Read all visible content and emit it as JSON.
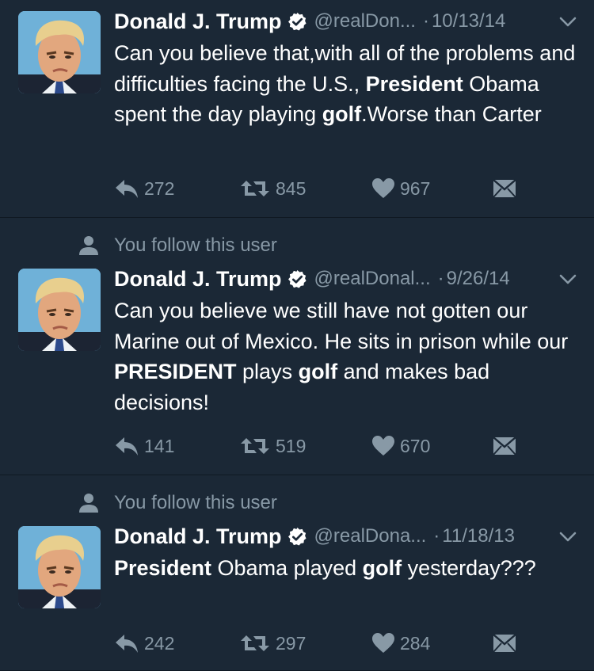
{
  "colors": {
    "background": "#1b2836",
    "muted": "#8899a6",
    "text": "#ffffff",
    "divider": "#0f1822"
  },
  "tweets": [
    {
      "name": "Donald J. Trump",
      "handle": "@realDon...",
      "dot": "·",
      "date": "10/13/14",
      "text_parts": [
        "Can you believe that,with all of the problems and difficulties facing the U.S., ",
        "President",
        " Obama spent the day playing ",
        "golf",
        ".Worse than Carter"
      ],
      "replies": "272",
      "retweets": "845",
      "likes": "967"
    },
    {
      "context": "You follow this user",
      "name": "Donald J. Trump",
      "handle": "@realDonal...",
      "dot": "·",
      "date": "9/26/14",
      "text_parts": [
        "Can you believe we still have not gotten our Marine out of Mexico. He sits in prison while our ",
        "PRESIDENT",
        " plays ",
        "golf",
        " and makes bad decisions!"
      ],
      "replies": "141",
      "retweets": "519",
      "likes": "670"
    },
    {
      "context": "You follow this user",
      "name": "Donald J. Trump",
      "handle": "@realDona...",
      "dot": "·",
      "date": "11/18/13",
      "text_parts": [
        "",
        "President",
        " Obama played ",
        "golf",
        " yesterday???"
      ],
      "replies": "242",
      "retweets": "297",
      "likes": "284"
    }
  ],
  "icons": [
    "person-icon",
    "verified-badge-icon",
    "chevron-down-icon",
    "reply-icon",
    "retweet-icon",
    "heart-icon",
    "direct-message-icon"
  ]
}
